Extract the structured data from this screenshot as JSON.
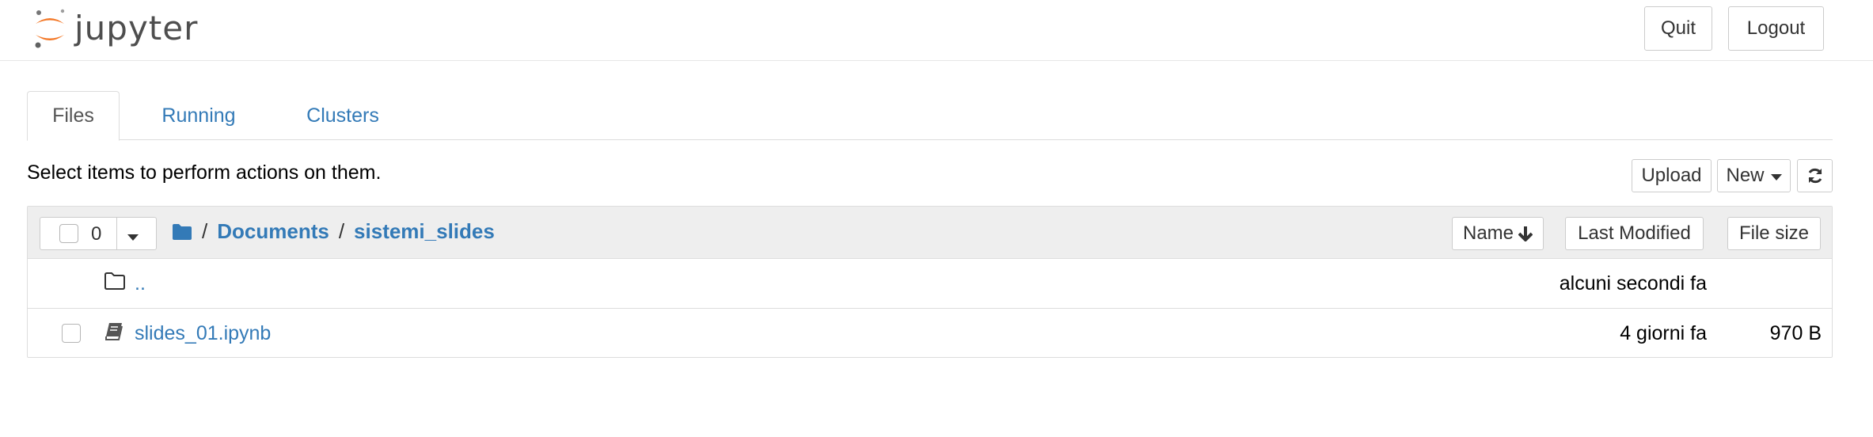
{
  "header": {
    "logo_text": "jupyter",
    "quit_label": "Quit",
    "logout_label": "Logout"
  },
  "tabs": [
    {
      "label": "Files",
      "active": true
    },
    {
      "label": "Running",
      "active": false
    },
    {
      "label": "Clusters",
      "active": false
    }
  ],
  "toolbar": {
    "hint": "Select items to perform actions on them.",
    "upload_label": "Upload",
    "new_label": "New"
  },
  "list_header": {
    "selected_count": "0",
    "breadcrumb": {
      "root_sep": "/",
      "items": [
        "Documents",
        "sistemi_slides"
      ],
      "sep": "/"
    },
    "sort_name_label": "Name",
    "sort_modified_label": "Last Modified",
    "sort_size_label": "File size"
  },
  "files": [
    {
      "name": "..",
      "type": "folder",
      "modified": "alcuni secondi fa",
      "size": ""
    },
    {
      "name": "slides_01.ipynb",
      "type": "notebook",
      "modified": "4 giorni fa",
      "size": "970 B"
    }
  ],
  "colors": {
    "link": "#337ab7",
    "logo_orange": "#f37726",
    "header_bg": "#eeeeee"
  },
  "icons": {
    "folder_open": "folder-icon",
    "notebook": "notebook-icon",
    "refresh": "refresh-icon",
    "sort_arrow": "arrow-down-icon"
  }
}
